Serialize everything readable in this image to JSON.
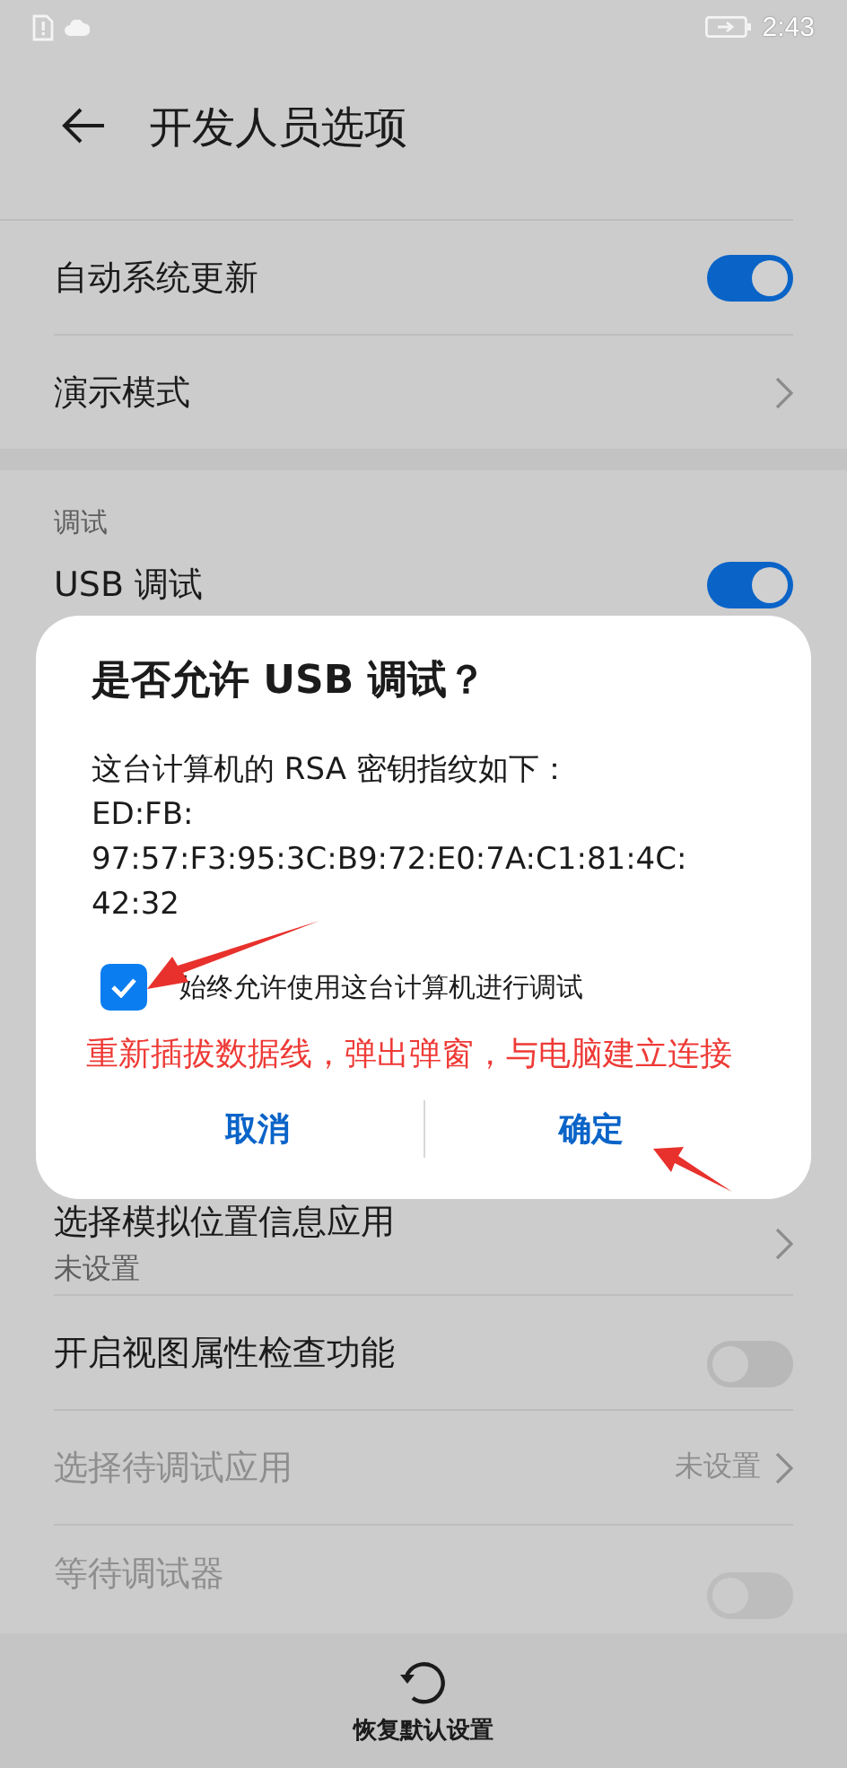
{
  "status_bar": {
    "time": "2:43"
  },
  "header": {
    "title": "开发人员选项"
  },
  "settings": {
    "above_dialog": [
      {
        "kind": "toggle",
        "label": "自动系统更新",
        "on": true,
        "disabled": false
      },
      {
        "kind": "link",
        "label": "演示模式",
        "disabled": false
      },
      {
        "kind": "section",
        "label": "调试"
      },
      {
        "kind": "toggle",
        "label": "USB 调试",
        "on": true,
        "disabled": false
      }
    ],
    "below_dialog": [
      {
        "kind": "link",
        "label": "选择模拟位置信息应用",
        "subtitle": "未设置",
        "disabled": false
      },
      {
        "kind": "toggle",
        "label": "开启视图属性检查功能",
        "on": false,
        "disabled": false
      },
      {
        "kind": "link",
        "label": "选择待调试应用",
        "value": "未设置",
        "disabled": true
      },
      {
        "kind": "toggle",
        "label": "等待调试器",
        "on": false,
        "disabled": true
      }
    ]
  },
  "dialog": {
    "title": "是否允许 USB 调试？",
    "message_lines": [
      "这台计算机的 RSA 密钥指纹如下：",
      "ED:FB:",
      "97:57:F3:95:3C:B9:72:E0:7A:C1:81:4C:",
      "42:32"
    ],
    "checkbox": {
      "label": "始终允许使用这台计算机进行调试",
      "checked": true
    },
    "annotation": "重新插拔数据线，弹出弹窗，与电脑建立连接",
    "buttons": [
      "取消",
      "确定"
    ]
  },
  "bottom_bar": {
    "label": "恢复默认设置"
  }
}
